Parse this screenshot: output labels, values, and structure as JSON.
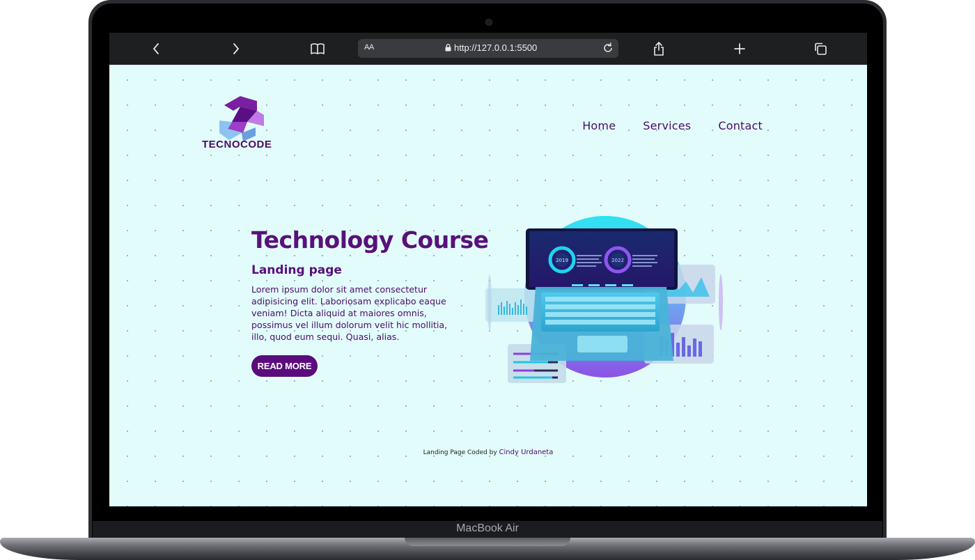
{
  "device": {
    "model_label": "MacBook Air"
  },
  "browser": {
    "url": "http://127.0.0.1:5500",
    "aa_label": "AA",
    "icons": [
      "back-icon",
      "forward-icon",
      "bookmarks-icon",
      "lock-icon",
      "reload-icon",
      "share-icon",
      "new-tab-icon",
      "tabs-icon"
    ]
  },
  "site": {
    "logo_text": "TECNOCODE",
    "nav": [
      {
        "label": "Home"
      },
      {
        "label": "Services"
      },
      {
        "label": "Contact"
      }
    ],
    "hero": {
      "title": "Technology Course",
      "subtitle": "Landing page",
      "body": "Lorem ipsum dolor sit amet consectetur adipisicing elit. Laboriosam explicabo eaque veniam! Dicta aliquid at maiores omnis, possimus vel illum dolorum velit hic mollitia, illo, quod eum sequi. Quasi, alias.",
      "cta_label": "READ MORE",
      "illustration": {
        "gauge_left": "2019",
        "gauge_right": "2022"
      }
    },
    "footer": {
      "prefix": "Landing Page Coded by",
      "author": "Cindy Urdaneta"
    },
    "colors": {
      "primary": "#58117a",
      "background": "#e2fbfb",
      "toolbar": "#1e1f21"
    }
  }
}
